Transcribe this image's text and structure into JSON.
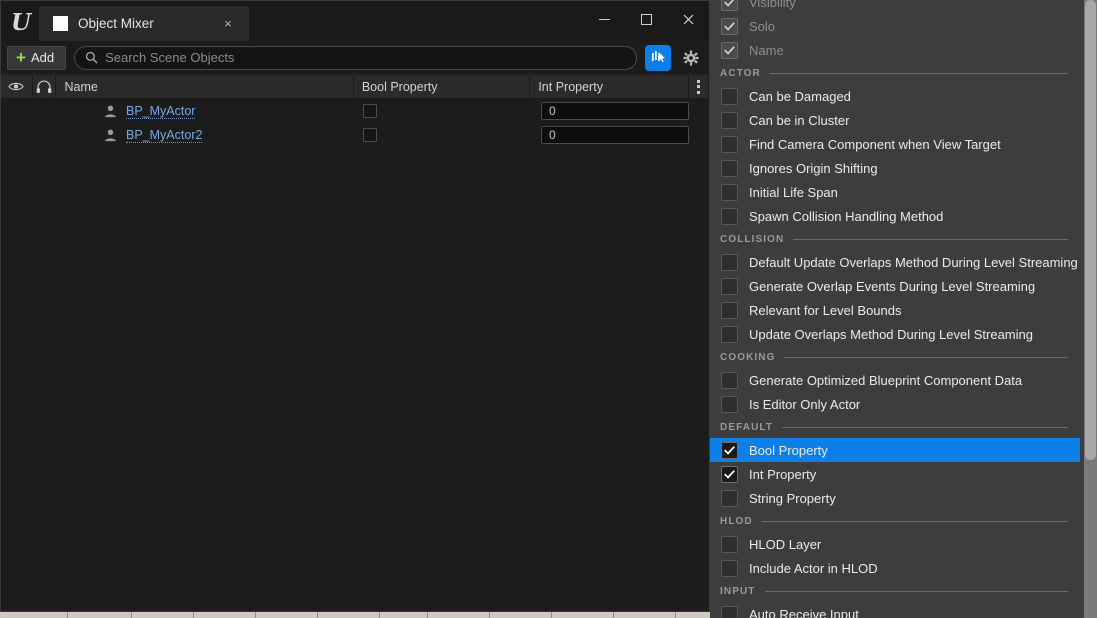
{
  "window": {
    "logo": "ue-logo",
    "tab_label": "Object Mixer",
    "close_label": "×",
    "minimize_label": "minimize",
    "maximize_label": "maximize",
    "close_window_label": "×"
  },
  "toolbar": {
    "add_label": "Add",
    "add_plus": "+",
    "search_placeholder": "Search Scene Objects",
    "sync_toggle_name": "sync-selection-toggle",
    "settings_name": "settings-gear"
  },
  "table": {
    "columns": [
      {
        "key": "visibility",
        "label": ""
      },
      {
        "key": "solo",
        "label": ""
      },
      {
        "key": "name",
        "label": "Name"
      },
      {
        "key": "bool_property",
        "label": "Bool Property"
      },
      {
        "key": "int_property",
        "label": "Int Property"
      }
    ],
    "rows": [
      {
        "name": "BP_MyActor",
        "bool_property": false,
        "int_property": "0"
      },
      {
        "name": "BP_MyActor2",
        "bool_property": false,
        "int_property": "0"
      }
    ]
  },
  "panel": {
    "items": [
      {
        "type": "item",
        "label": "Visibility",
        "checked": true,
        "disabled": true,
        "selected": false
      },
      {
        "type": "item",
        "label": "Solo",
        "checked": true,
        "disabled": true,
        "selected": false
      },
      {
        "type": "item",
        "label": "Name",
        "checked": true,
        "disabled": true,
        "selected": false
      },
      {
        "type": "section",
        "label": "ACTOR"
      },
      {
        "type": "item",
        "label": "Can be Damaged",
        "checked": false,
        "disabled": false,
        "selected": false
      },
      {
        "type": "item",
        "label": "Can be in Cluster",
        "checked": false,
        "disabled": false,
        "selected": false
      },
      {
        "type": "item",
        "label": "Find Camera Component when View Target",
        "checked": false,
        "disabled": false,
        "selected": false
      },
      {
        "type": "item",
        "label": "Ignores Origin Shifting",
        "checked": false,
        "disabled": false,
        "selected": false
      },
      {
        "type": "item",
        "label": "Initial Life Span",
        "checked": false,
        "disabled": false,
        "selected": false
      },
      {
        "type": "item",
        "label": "Spawn Collision Handling Method",
        "checked": false,
        "disabled": false,
        "selected": false
      },
      {
        "type": "section",
        "label": "COLLISION"
      },
      {
        "type": "item",
        "label": "Default Update Overlaps Method During Level Streaming",
        "checked": false,
        "disabled": false,
        "selected": false
      },
      {
        "type": "item",
        "label": "Generate Overlap Events During Level Streaming",
        "checked": false,
        "disabled": false,
        "selected": false
      },
      {
        "type": "item",
        "label": "Relevant for Level Bounds",
        "checked": false,
        "disabled": false,
        "selected": false
      },
      {
        "type": "item",
        "label": "Update Overlaps Method During Level Streaming",
        "checked": false,
        "disabled": false,
        "selected": false
      },
      {
        "type": "section",
        "label": "COOKING"
      },
      {
        "type": "item",
        "label": "Generate Optimized Blueprint Component Data",
        "checked": false,
        "disabled": false,
        "selected": false
      },
      {
        "type": "item",
        "label": "Is Editor Only Actor",
        "checked": false,
        "disabled": false,
        "selected": false
      },
      {
        "type": "section",
        "label": "DEFAULT"
      },
      {
        "type": "item",
        "label": "Bool Property",
        "checked": true,
        "disabled": false,
        "selected": true
      },
      {
        "type": "item",
        "label": "Int Property",
        "checked": true,
        "disabled": false,
        "selected": false
      },
      {
        "type": "item",
        "label": "String Property",
        "checked": false,
        "disabled": false,
        "selected": false
      },
      {
        "type": "section",
        "label": "HLOD"
      },
      {
        "type": "item",
        "label": "HLOD Layer",
        "checked": false,
        "disabled": false,
        "selected": false
      },
      {
        "type": "item",
        "label": "Include Actor in HLOD",
        "checked": false,
        "disabled": false,
        "selected": false
      },
      {
        "type": "section",
        "label": "INPUT"
      },
      {
        "type": "item",
        "label": "Auto Receive Input",
        "checked": false,
        "disabled": false,
        "selected": false
      }
    ]
  },
  "colors": {
    "accent_blue": "#0d7fe8",
    "add_green": "#8ede4a",
    "panel_bg": "#3d3d3d",
    "window_bg": "#1c1c1c",
    "link_blue": "#7ba7e0"
  }
}
